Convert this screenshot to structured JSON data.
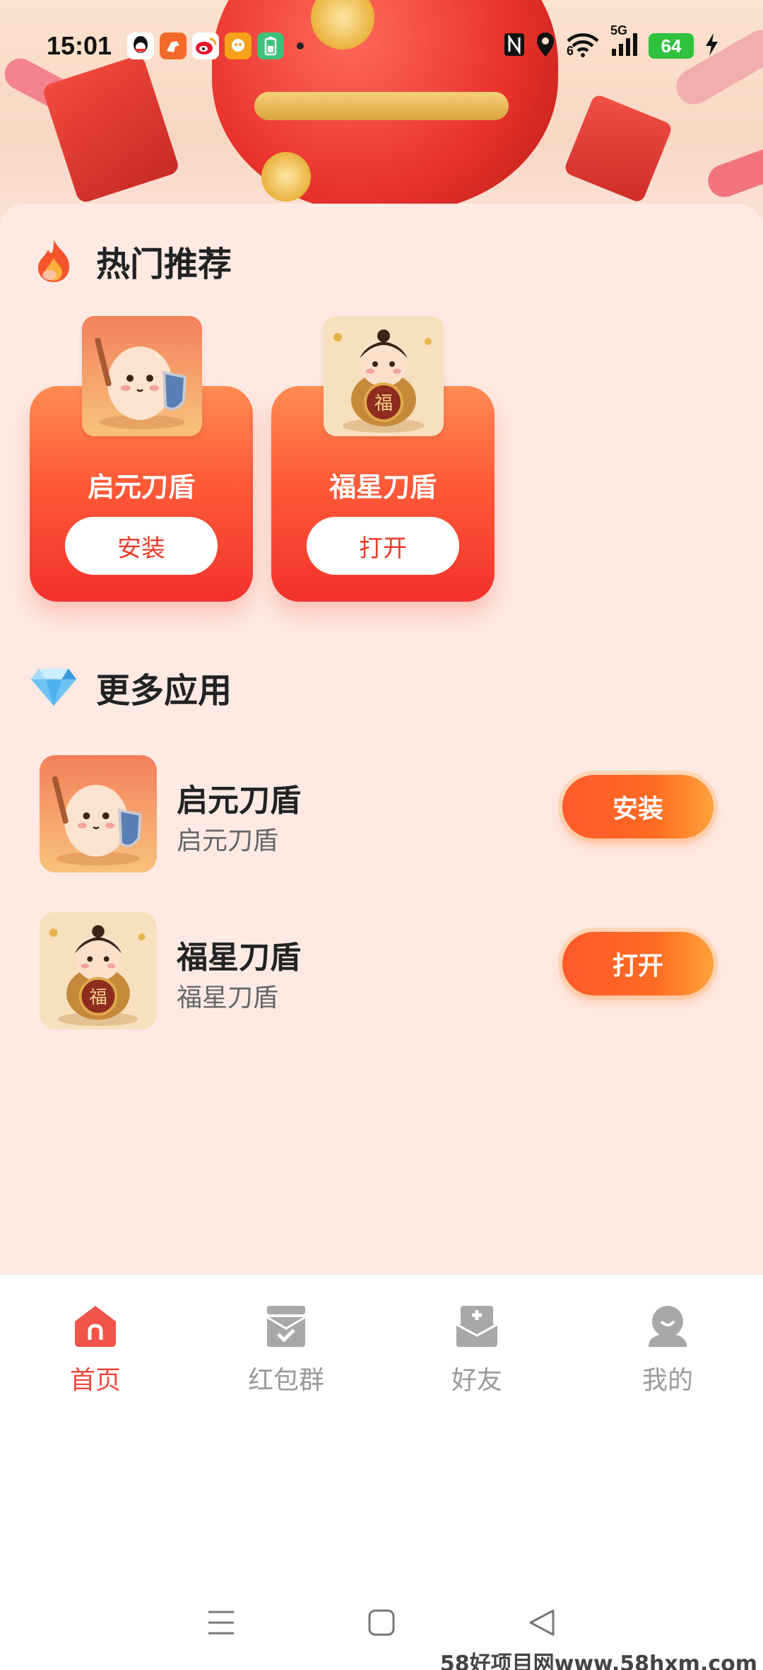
{
  "status_bar": {
    "time": "15:01",
    "battery": "64",
    "network": "5G",
    "wifi_sub": "6",
    "icons_left": [
      "qq-icon",
      "horse-app-icon",
      "weibo-icon",
      "app-icon",
      "battery-app-icon"
    ],
    "icons_right": [
      "nfc-icon",
      "location-icon",
      "wifi-icon",
      "signal-icon",
      "charging-icon"
    ]
  },
  "hot_section": {
    "title": "热门推荐",
    "icon": "fire-icon",
    "cards": [
      {
        "name": "启元刀盾",
        "button": "安装",
        "thumb": "egg-warrior-icon"
      },
      {
        "name": "福星刀盾",
        "button": "打开",
        "thumb": "fortune-kid-icon"
      }
    ]
  },
  "more_section": {
    "title": "更多应用",
    "icon": "diamond-icon",
    "items": [
      {
        "title": "启元刀盾",
        "subtitle": "启元刀盾",
        "button": "安装",
        "thumb": "egg-warrior-icon"
      },
      {
        "title": "福星刀盾",
        "subtitle": "福星刀盾",
        "button": "打开",
        "thumb": "fortune-kid-icon"
      }
    ]
  },
  "tabs": [
    {
      "label": "首页",
      "icon": "home-icon",
      "active": true
    },
    {
      "label": "红包群",
      "icon": "red-packet-group-icon",
      "active": false
    },
    {
      "label": "好友",
      "icon": "friends-icon",
      "active": false
    },
    {
      "label": "我的",
      "icon": "profile-icon",
      "active": false
    }
  ],
  "colors": {
    "accent": "#f0483c",
    "background": "#feeae3",
    "tab_inactive": "#9a9a9a"
  },
  "watermark": "58好项目网www.58hxm.com"
}
